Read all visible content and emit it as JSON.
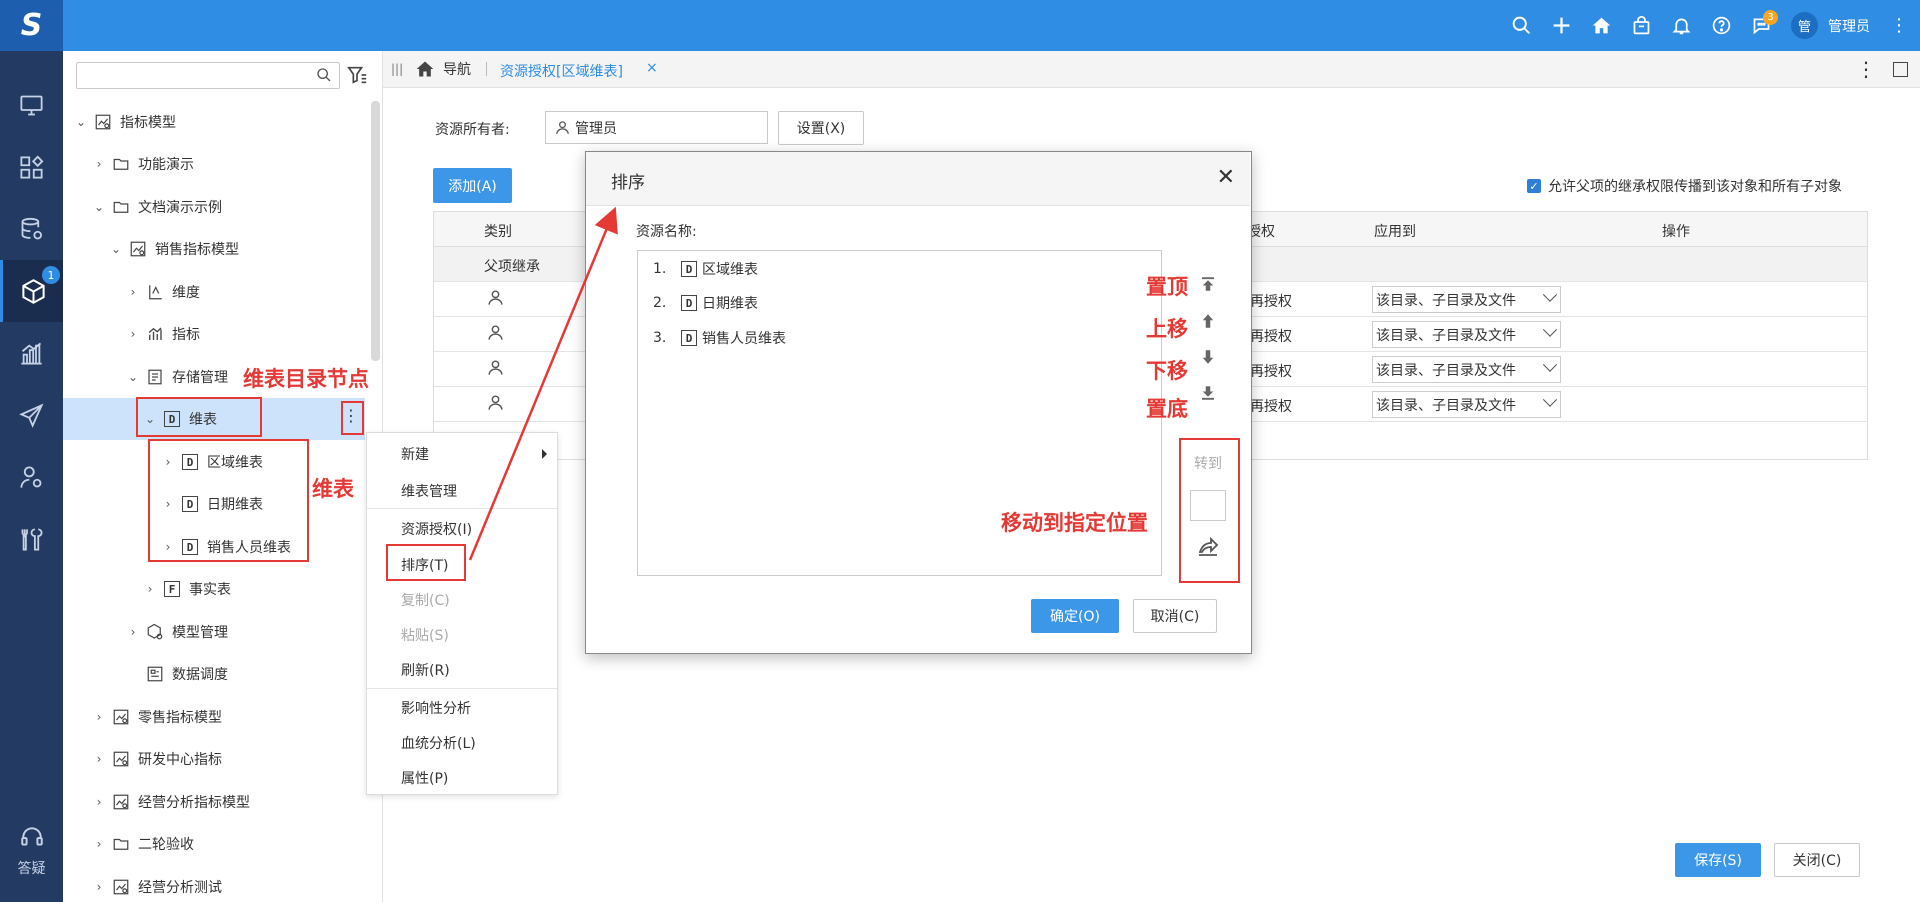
{
  "topbar": {
    "logo_text": "S",
    "notification_count": "3",
    "avatar_text": "管",
    "username": "管理员"
  },
  "rail": {
    "active_badge": "1",
    "help_label": "答疑"
  },
  "tree": {
    "search": {
      "value": "",
      "placeholder": ""
    },
    "nodes": [
      {
        "label": "指标模型"
      },
      {
        "label": "功能演示"
      },
      {
        "label": "文档演示示例"
      },
      {
        "label": "销售指标模型"
      },
      {
        "label": "维度"
      },
      {
        "label": "指标"
      },
      {
        "label": "存储管理"
      },
      {
        "label": "维表"
      },
      {
        "label": "区域维表"
      },
      {
        "label": "日期维表"
      },
      {
        "label": "销售人员维表"
      },
      {
        "label": "事实表"
      },
      {
        "label": "模型管理"
      },
      {
        "label": "数据调度"
      },
      {
        "label": "零售指标模型"
      },
      {
        "label": "研发中心指标"
      },
      {
        "label": "经营分析指标模型"
      },
      {
        "label": "二轮验收"
      },
      {
        "label": "经营分析测试"
      }
    ],
    "d_glyph": "D",
    "f_glyph": "F"
  },
  "context_menu": {
    "items": [
      {
        "label": "新建"
      },
      {
        "label": "维表管理"
      },
      {
        "label": "资源授权(I)"
      },
      {
        "label": "排序(T)"
      },
      {
        "label": "复制(C)"
      },
      {
        "label": "粘贴(S)"
      },
      {
        "label": "刷新(R)"
      },
      {
        "label": "影响性分析"
      },
      {
        "label": "血统分析(L)"
      },
      {
        "label": "属性(P)"
      }
    ]
  },
  "tabs": {
    "home_label": "导航",
    "active_label": "资源授权[区域维表]",
    "close_glyph": "×"
  },
  "main": {
    "owner_label": "资源所有者:",
    "owner_value": "管理员",
    "set_button": "设置(X)",
    "add_button": "添加(A)",
    "inherit_checkbox_label": "允许父项的继承权限传播到该对象和所有子对象",
    "columns": {
      "category": "类别",
      "grant": "授权",
      "apply_to": "应用到",
      "action": "操作"
    },
    "group_row_label": "父项继承",
    "rows": [
      {
        "grant": "再授权",
        "apply_to": "该目录、子目录及文件"
      },
      {
        "grant": "再授权",
        "apply_to": "该目录、子目录及文件"
      },
      {
        "grant": "再授权",
        "apply_to": "该目录、子目录及文件"
      },
      {
        "grant": "再授权",
        "apply_to": "该目录、子目录及文件"
      }
    ],
    "save_button": "保存(S)",
    "close_button": "关闭(C)"
  },
  "dialog": {
    "title": "排序",
    "close_glyph": "✕",
    "resource_label": "资源名称:",
    "items": [
      {
        "num": "1.",
        "label": "区域维表"
      },
      {
        "num": "2.",
        "label": "日期维表"
      },
      {
        "num": "3.",
        "label": "销售人员维表"
      }
    ],
    "goto_label": "转到",
    "goto_value": "",
    "ok_button": "确定(O)",
    "cancel_button": "取消(C)"
  },
  "annotations": {
    "dim_dir_node": "维表目录节点",
    "dims": "维表",
    "top": "置顶",
    "up": "上移",
    "down": "下移",
    "bottom": "置底",
    "move_to": "移动到指定位置"
  },
  "colors": {
    "topbar": "#2f8de4",
    "rail": "#233b63",
    "primary_button": "#3d97e8",
    "annotation_red": "#e53935",
    "selected_node": "#cce3fb"
  }
}
